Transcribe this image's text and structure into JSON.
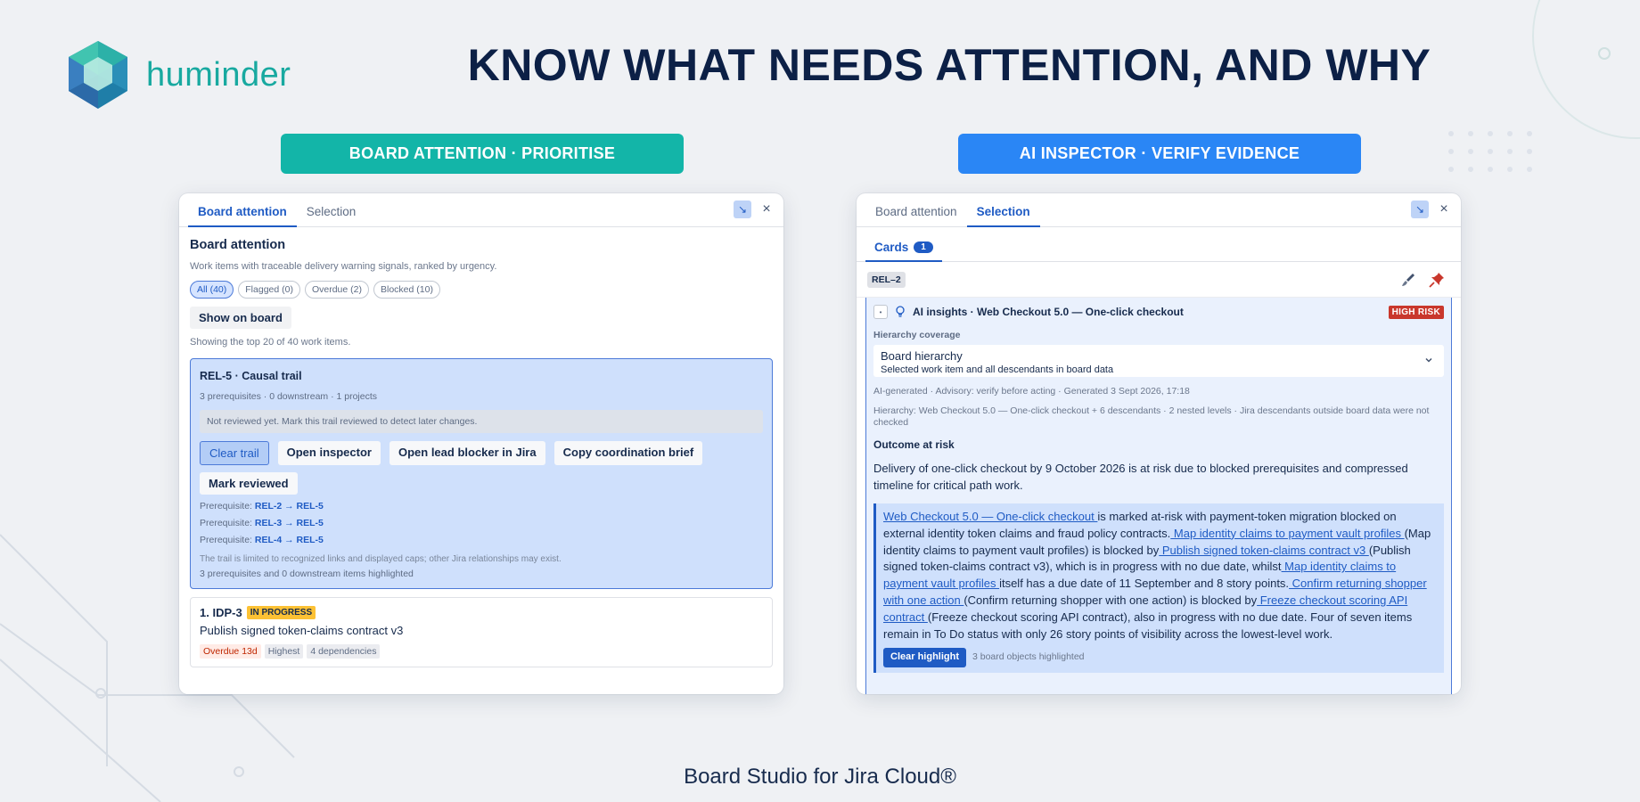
{
  "brand": {
    "name": "huminder",
    "accent": "#18a9a0"
  },
  "headline": "KNOW WHAT NEEDS ATTENTION, AND WHY",
  "pills": {
    "left": "BOARD ATTENTION · PRIORITISE",
    "right": "AI INSPECTOR · VERIFY EVIDENCE"
  },
  "left_panel": {
    "tabs": [
      "Board attention",
      "Selection"
    ],
    "active_tab": "Board attention",
    "title": "Board attention",
    "subtitle": "Work items with traceable delivery warning signals, ranked by urgency.",
    "filters": [
      "All (40)",
      "Flagged (0)",
      "Overdue (2)",
      "Blocked (10)"
    ],
    "show_on_board": "Show on board",
    "showing": "Showing the top 20 of 40 work items.",
    "trail": {
      "title": "REL-5 · Causal trail",
      "meta": "3 prerequisites · 0 downstream · 1 projects",
      "note": "Not reviewed yet. Mark this trail reviewed to detect later changes.",
      "buttons": [
        "Clear trail",
        "Open inspector",
        "Open lead blocker in Jira",
        "Copy coordination brief",
        "Mark reviewed"
      ],
      "prereq_label": "Prerequisite:",
      "prereqs": [
        "REL-2 → REL-5",
        "REL-3 → REL-5",
        "REL-4 → REL-5"
      ],
      "limit_note": "The trail is limited to recognized links and displayed caps; other Jira relationships may exist.",
      "highlight_note": "3 prerequisites and 0 downstream items highlighted"
    },
    "item": {
      "key": "1. IDP-3",
      "status": "IN PROGRESS",
      "title": "Publish signed token-claims contract v3",
      "tags": [
        "Overdue 13d",
        "Highest",
        "4 dependencies"
      ]
    }
  },
  "right_panel": {
    "tabs": [
      "Board attention",
      "Selection"
    ],
    "active_tab": "Selection",
    "subtab": "Cards",
    "subtab_count": "1",
    "card_key": "REL–2",
    "insight": {
      "title": "AI insights · Web Checkout 5.0 — One-click checkout",
      "risk": "HIGH RISK",
      "coverage_label": "Hierarchy coverage",
      "coverage_value": "Board hierarchy",
      "coverage_desc": "Selected work item and all descendants in board data",
      "generated": "AI-generated · Advisory: verify before acting · Generated 3 Sept 2026, 17:18",
      "hierarchy": "Hierarchy:  Web Checkout 5.0 — One-click checkout  + 6 descendants · 2 nested levels · Jira descendants outside board data were not checked",
      "outcome_heading": "Outcome at risk",
      "outcome_text": "Delivery of one-click checkout by 9 October 2026 is at risk due to blocked prerequisites and compressed timeline for critical path work.",
      "evidence": [
        {
          "t": "link",
          "v": " Web Checkout 5.0 — One-click checkout "
        },
        {
          "t": "text",
          "v": "is marked at-risk with payment-token migration blocked on external identity token claims and fraud policy contracts."
        },
        {
          "t": "link",
          "v": " Map identity claims to payment vault profiles "
        },
        {
          "t": "text",
          "v": "(Map identity claims to payment vault profiles) is blocked by"
        },
        {
          "t": "link",
          "v": " Publish signed token-claims contract v3 "
        },
        {
          "t": "text",
          "v": "(Publish signed token-claims contract v3), which is in progress with no due date, whilst"
        },
        {
          "t": "link",
          "v": " Map identity claims to payment vault profiles "
        },
        {
          "t": "text",
          "v": "itself has a due date of 11 September and 8 story points."
        },
        {
          "t": "link",
          "v": " Confirm returning shopper with one action "
        },
        {
          "t": "text",
          "v": "(Confirm returning shopper with one action) is blocked by"
        },
        {
          "t": "link",
          "v": " Freeze checkout scoring API contract "
        },
        {
          "t": "text",
          "v": "(Freeze checkout scoring API contract), also in progress with no due date. Four of seven items remain in To Do status with only 26 story points of visibility across the lowest-level work."
        }
      ],
      "clear_highlight": "Clear highlight",
      "highlight_count": "3 board objects highlighted"
    }
  },
  "footer": "Board Studio for Jira Cloud®",
  "colors": {
    "navy": "#0c2046",
    "teal": "#13b5a8",
    "blue": "#2a86f5",
    "link": "#1f5bc4",
    "risk": "#c9372c",
    "status": "#fcc134"
  }
}
